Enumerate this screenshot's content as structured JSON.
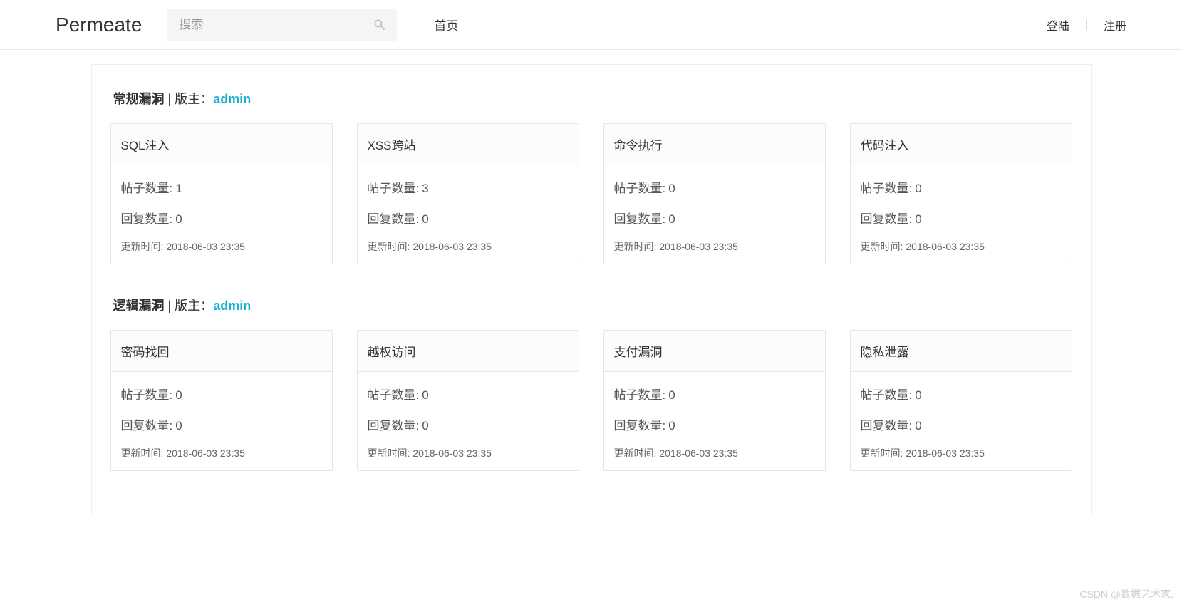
{
  "header": {
    "brand": "Permeate",
    "search_placeholder": "搜索",
    "nav_home": "首页",
    "login": "登陆",
    "register": "注册",
    "sep": "|"
  },
  "labels": {
    "owner_prefix": " | 版主：",
    "posts": "帖子数量:",
    "replies": "回复数量:",
    "updated": "更新时间:"
  },
  "sections": [
    {
      "title": "常规漏洞",
      "admin": "admin",
      "cards": [
        {
          "name": "SQL注入",
          "posts": "1",
          "replies": "0",
          "updated": "2018-06-03 23:35"
        },
        {
          "name": "XSS跨站",
          "posts": "3",
          "replies": "0",
          "updated": "2018-06-03 23:35"
        },
        {
          "name": "命令执行",
          "posts": "0",
          "replies": "0",
          "updated": "2018-06-03 23:35"
        },
        {
          "name": "代码注入",
          "posts": "0",
          "replies": "0",
          "updated": "2018-06-03 23:35"
        }
      ]
    },
    {
      "title": "逻辑漏洞",
      "admin": "admin",
      "cards": [
        {
          "name": "密码找回",
          "posts": "0",
          "replies": "0",
          "updated": "2018-06-03 23:35"
        },
        {
          "name": "越权访问",
          "posts": "0",
          "replies": "0",
          "updated": "2018-06-03 23:35"
        },
        {
          "name": "支付漏洞",
          "posts": "0",
          "replies": "0",
          "updated": "2018-06-03 23:35"
        },
        {
          "name": "隐私泄露",
          "posts": "0",
          "replies": "0",
          "updated": "2018-06-03 23:35"
        }
      ]
    }
  ],
  "watermark": "CSDN @数据艺术家."
}
